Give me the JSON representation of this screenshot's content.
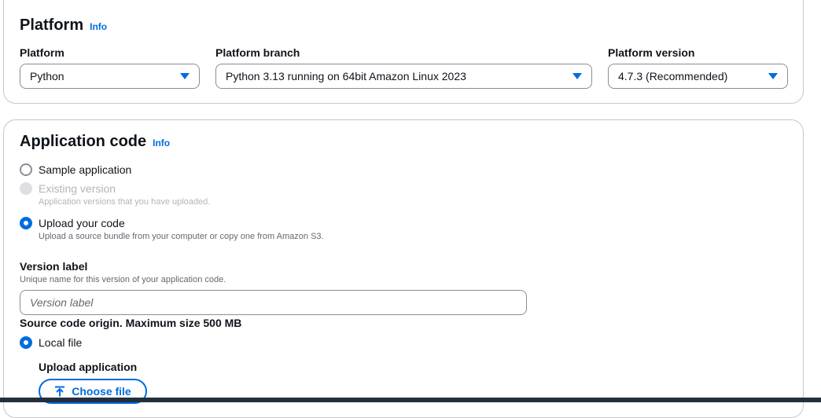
{
  "platform_section": {
    "title": "Platform",
    "info": "Info",
    "platform": {
      "label": "Platform",
      "value": "Python"
    },
    "branch": {
      "label": "Platform branch",
      "value": "Python 3.13 running on 64bit Amazon Linux 2023"
    },
    "version": {
      "label": "Platform version",
      "value": "4.7.3 (Recommended)"
    }
  },
  "app_code_section": {
    "title": "Application code",
    "info": "Info",
    "options": [
      {
        "label": "Sample application",
        "description": "",
        "state": "unchecked"
      },
      {
        "label": "Existing version",
        "description": "Application versions that you have uploaded.",
        "state": "disabled"
      },
      {
        "label": "Upload your code",
        "description": "Upload a source bundle from your computer or copy one from Amazon S3.",
        "state": "checked"
      }
    ],
    "version_label": {
      "label": "Version label",
      "description": "Unique name for this version of your application code.",
      "placeholder": "Version label",
      "value": ""
    },
    "source_origin": {
      "label": "Source code origin. Maximum size 500 MB",
      "option": "Local file"
    },
    "upload": {
      "label": "Upload application",
      "button": "Choose file",
      "button_icon": "upload-icon"
    }
  },
  "colors": {
    "accent": "#006ce0",
    "text": "#0f141a",
    "muted": "#656871",
    "border": "#c6c6cd"
  }
}
